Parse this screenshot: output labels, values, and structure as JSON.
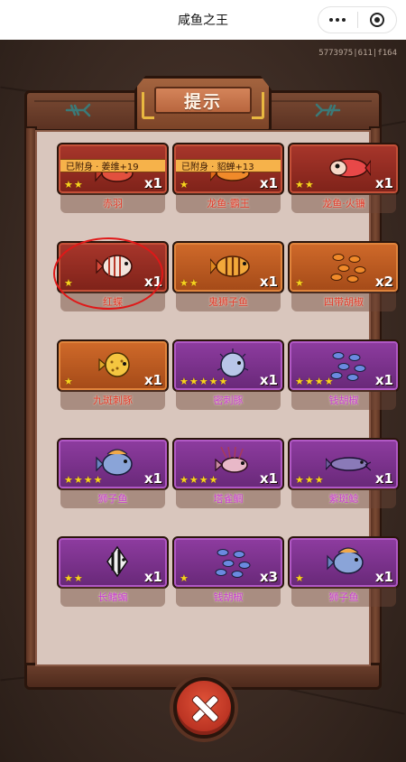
{
  "navbar": {
    "title": "咸鱼之王"
  },
  "version": "5773975|611|f164",
  "panel": {
    "title": "提示"
  },
  "cards": [
    {
      "name": "赤羽",
      "count": "x1",
      "stars": 2,
      "theme": "red",
      "owned": "已附身 · 姜维+19",
      "fish": "red"
    },
    {
      "name": "龙鱼·霸王",
      "count": "x1",
      "stars": 1,
      "theme": "red",
      "owned": "已附身 · 貂蝉+13",
      "fish": "orange"
    },
    {
      "name": "龙鱼·火镰",
      "count": "x1",
      "stars": 2,
      "theme": "red",
      "owned": "",
      "fish": "arowana"
    },
    {
      "name": "红蝶",
      "count": "x1",
      "stars": 1,
      "theme": "red",
      "owned": "",
      "fish": "butterfly"
    },
    {
      "name": "鬼狮子鱼",
      "count": "x1",
      "stars": 2,
      "theme": "orange",
      "owned": "",
      "fish": "tiger"
    },
    {
      "name": "四带胡椒",
      "count": "x2",
      "stars": 1,
      "theme": "orange",
      "owned": "",
      "fish": "school-orange"
    },
    {
      "name": "九斑刺豚",
      "count": "x1",
      "stars": 1,
      "theme": "orange",
      "owned": "",
      "fish": "puffer-yellow"
    },
    {
      "name": "密刺豚",
      "count": "x1",
      "stars": 5,
      "theme": "purple",
      "owned": "",
      "fish": "puffer-blue"
    },
    {
      "name": "钱胡椒",
      "count": "x1",
      "stars": 4,
      "theme": "purple",
      "owned": "",
      "fish": "school-blue"
    },
    {
      "name": "狮子鱼",
      "count": "x1",
      "stars": 4,
      "theme": "purple",
      "owned": "",
      "fish": "blue-round"
    },
    {
      "name": "塔雀鲷",
      "count": "x1",
      "stars": 4,
      "theme": "purple",
      "owned": "",
      "fish": "lion"
    },
    {
      "name": "紫斑鲶",
      "count": "x1",
      "stars": 3,
      "theme": "purple",
      "owned": "",
      "fish": "catfish"
    },
    {
      "name": "长鳍蝙",
      "count": "x1",
      "stars": 2,
      "theme": "purple",
      "owned": "",
      "fish": "angel"
    },
    {
      "name": "钱胡椒",
      "count": "x3",
      "stars": 1,
      "theme": "purple",
      "owned": "",
      "fish": "school-blue"
    },
    {
      "name": "狮子鱼",
      "count": "x1",
      "stars": 1,
      "theme": "purple",
      "owned": "",
      "fish": "blue-round"
    }
  ],
  "highlighted_index": 3,
  "colors": {
    "red_card": "#a8362b",
    "orange_card": "#d06a2a",
    "purple_card": "#8e3ca0",
    "star": "#f7d21e",
    "name_red": "#e23a2a",
    "name_purple": "#c73cd2"
  }
}
